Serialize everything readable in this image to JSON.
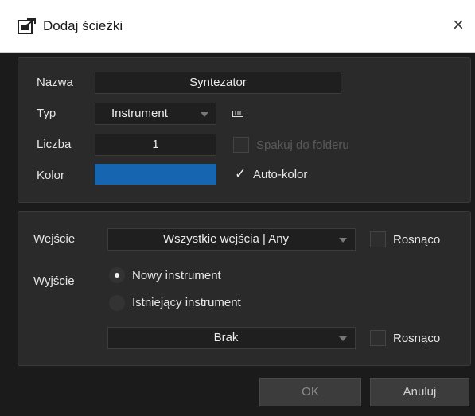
{
  "window": {
    "title": "Dodaj ścieżki",
    "close_glyph": "×",
    "icon": "add-track-icon"
  },
  "track": {
    "name_label": "Nazwa",
    "name_value": "Syntezator",
    "type_label": "Typ",
    "type_value": "Instrument",
    "type_icon": "keyboard-icon",
    "count_label": "Liczba",
    "count_value": "1",
    "pack_folder_label": "Spakuj do folderu",
    "pack_folder_checked": false,
    "pack_folder_enabled": false,
    "color_label": "Kolor",
    "color_value": "#1565b0",
    "auto_color_label": "Auto-kolor",
    "auto_color_checked": true
  },
  "routing": {
    "input_label": "Wejście",
    "input_value": "Wszystkie wejścia | Any",
    "input_ascending_label": "Rosnąco",
    "input_ascending_checked": false,
    "output_label": "Wyjście",
    "new_instrument_label": "Nowy instrument",
    "new_instrument_selected": true,
    "existing_instrument_label": "Istniejący instrument",
    "existing_instrument_selected": false,
    "existing_value": "Brak",
    "existing_ascending_label": "Rosnąco",
    "existing_ascending_checked": false
  },
  "buttons": {
    "ok_label": "OK",
    "cancel_label": "Anuluj"
  },
  "colors": {
    "dialog_bg": "#1b1b1b",
    "panel_bg": "#2a2a2a",
    "accent_blue": "#1565b0"
  }
}
